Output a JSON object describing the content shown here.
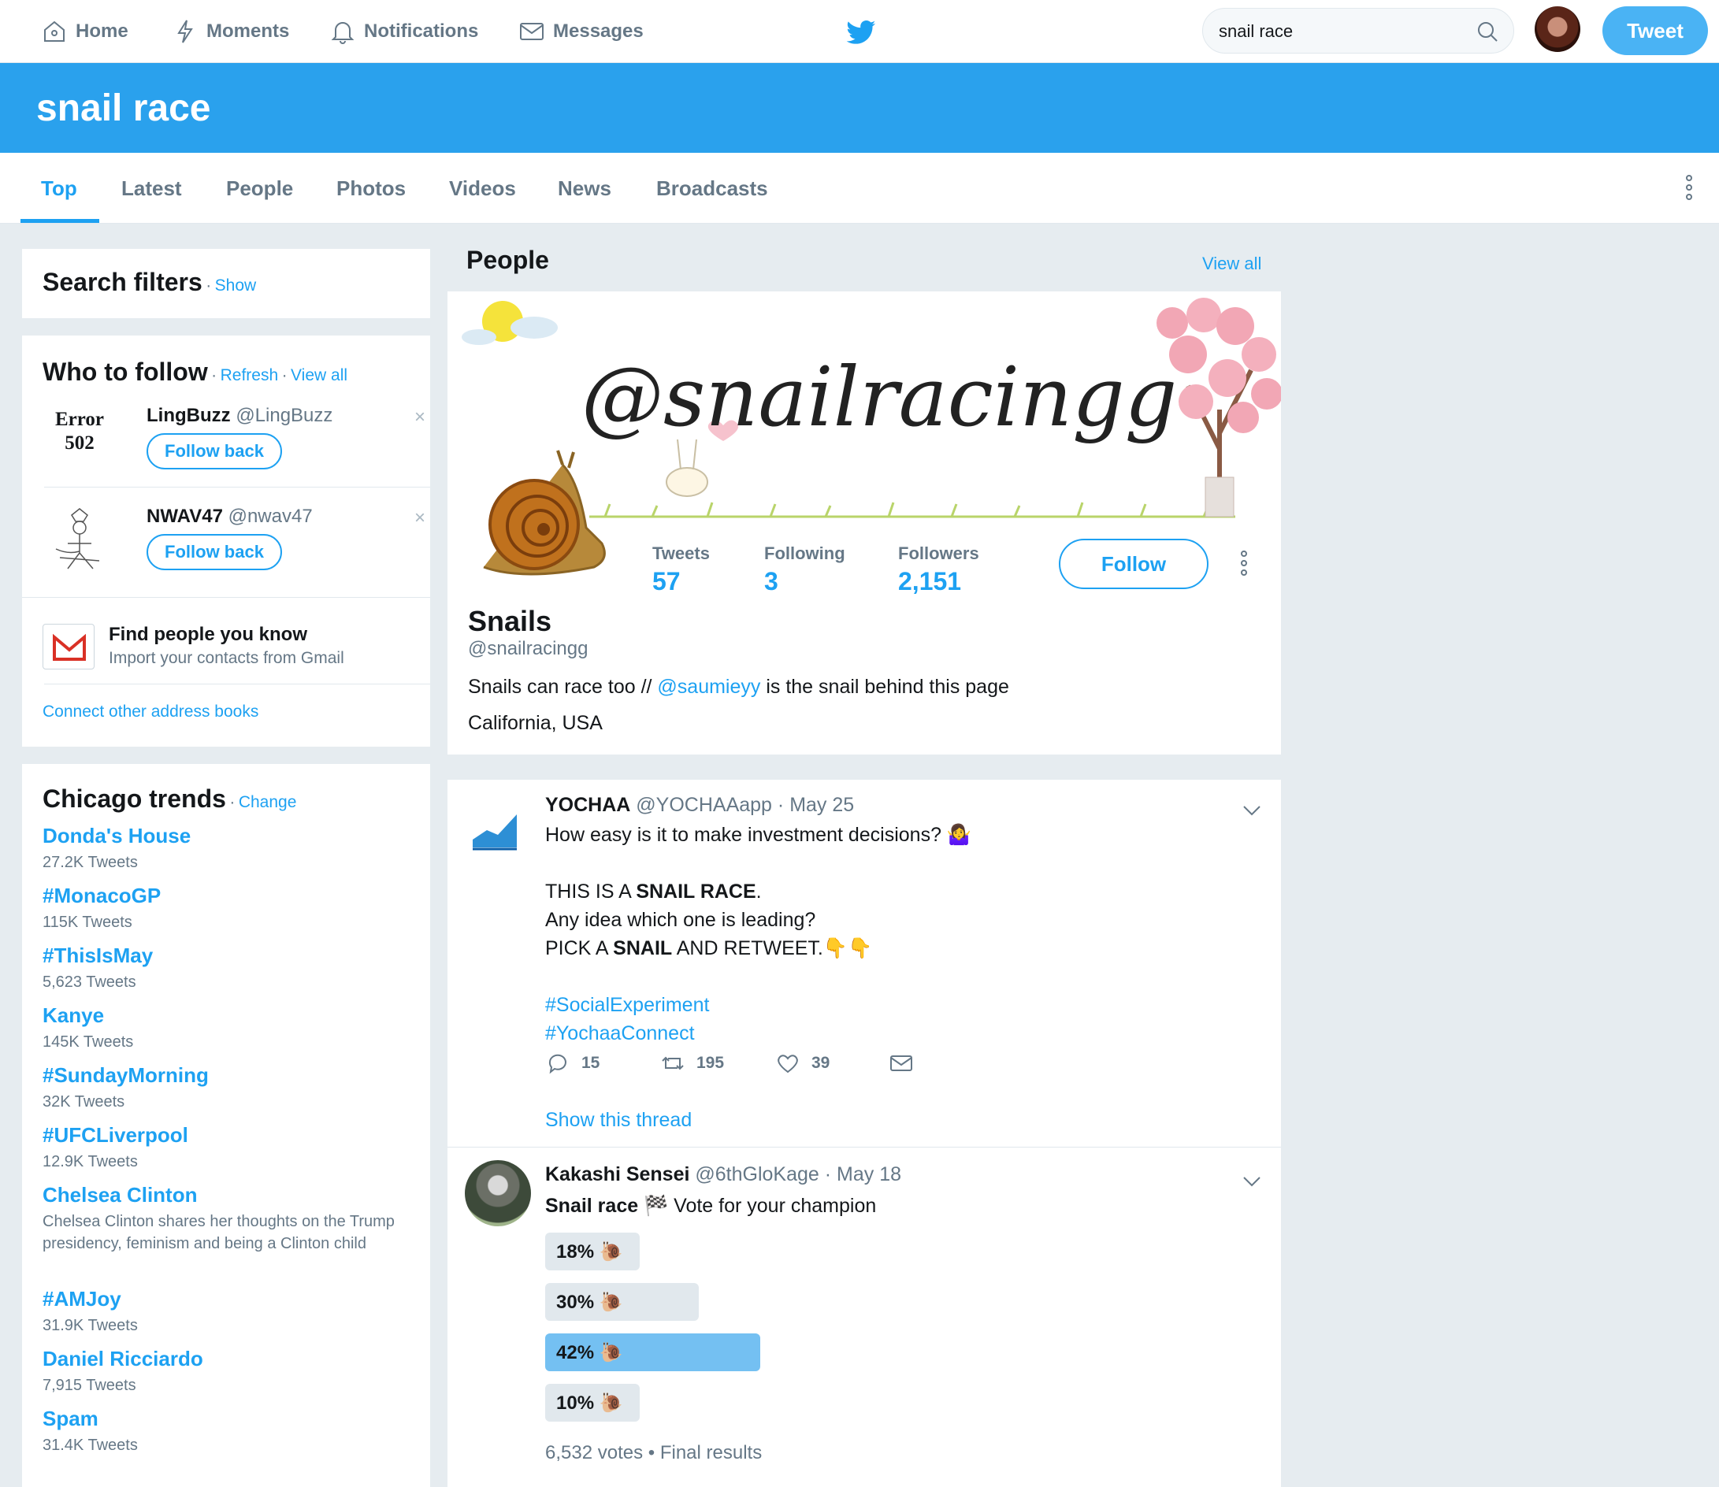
{
  "nav": {
    "home": "Home",
    "moments": "Moments",
    "notifications": "Notifications",
    "messages": "Messages",
    "search_value": "snail race",
    "tweet_button": "Tweet"
  },
  "header": {
    "title": "snail race"
  },
  "tabs": [
    "Top",
    "Latest",
    "People",
    "Photos",
    "Videos",
    "News",
    "Broadcasts"
  ],
  "search_filters": {
    "title": "Search filters",
    "show": "Show"
  },
  "who_to_follow": {
    "title": "Who to follow",
    "refresh": "Refresh",
    "view_all": "View all",
    "accounts": [
      {
        "avatar_text_1": "Error",
        "avatar_text_2": "502",
        "name": "LingBuzz",
        "handle": "@LingBuzz",
        "button": "Follow back"
      },
      {
        "name": "NWAV47",
        "handle": "@nwav47",
        "button": "Follow back"
      }
    ],
    "find_title": "Find people you know",
    "find_sub": "Import your contacts from Gmail",
    "connect": "Connect other address books"
  },
  "trends": {
    "title": "Chicago trends",
    "change": "Change",
    "items": [
      {
        "name": "Donda's House",
        "count": "27.2K Tweets"
      },
      {
        "name": "#MonacoGP",
        "count": "115K Tweets"
      },
      {
        "name": "#ThisIsMay",
        "count": "5,623 Tweets"
      },
      {
        "name": "Kanye",
        "count": "145K Tweets"
      },
      {
        "name": "#SundayMorning",
        "count": "32K Tweets"
      },
      {
        "name": "#UFCLiverpool",
        "count": "12.9K Tweets"
      },
      {
        "name": "Chelsea Clinton",
        "count": "Chelsea Clinton shares her thoughts on the Trump presidency, feminism and being a Clinton child"
      },
      {
        "name": "#AMJoy",
        "count": "31.9K Tweets"
      },
      {
        "name": "Daniel Ricciardo",
        "count": "7,915 Tweets"
      },
      {
        "name": "Spam",
        "count": "31.4K Tweets"
      }
    ]
  },
  "people": {
    "title": "People",
    "view_all": "View all",
    "banner_text": "@snailracingg",
    "name": "Snails",
    "handle": "@snailracingg",
    "stats": [
      {
        "label": "Tweets",
        "value": "57"
      },
      {
        "label": "Following",
        "value": "3"
      },
      {
        "label": "Followers",
        "value": "2,151"
      }
    ],
    "follow_button": "Follow",
    "bio_before": "Snails can race too // ",
    "bio_mention": "@saumieyy",
    "bio_after": " is the snail behind this page",
    "location": "California, USA"
  },
  "tweets": [
    {
      "name": "YOCHAA",
      "handle": "@YOCHAAapp",
      "date": "· May 25",
      "line1": "How easy is it to make investment decisions? 🤷‍♀️",
      "line2_a": "THIS IS A ",
      "line2_b": "SNAIL RACE",
      "line2_c": ".",
      "line3": "Any idea which one is leading?",
      "line4_a": "PICK A ",
      "line4_b": "SNAIL",
      "line4_c": " AND RETWEET.👇👇",
      "hashtag1": "#SocialExperiment",
      "hashtag2": "#YochaaConnect",
      "replies": "15",
      "retweets": "195",
      "likes": "39",
      "thread": "Show this thread"
    },
    {
      "name": "Kakashi Sensei",
      "handle": "@6thGloKage",
      "date": "· May 18",
      "text_bold": "Snail race",
      "text_rest": " 🏁 Vote for your champion",
      "poll": [
        {
          "label": "18% 🐌",
          "fraction": 0.18
        },
        {
          "label": "30% 🐌",
          "fraction": 0.3
        },
        {
          "label": "42% 🐌",
          "fraction": 0.42
        },
        {
          "label": "10% 🐌",
          "fraction": 0.1
        }
      ],
      "poll_footer": "6,532 votes • Final results"
    }
  ],
  "colors": {
    "accent": "#1da1f2",
    "banner": "#2aa1ed",
    "background": "#e6ecf0"
  }
}
